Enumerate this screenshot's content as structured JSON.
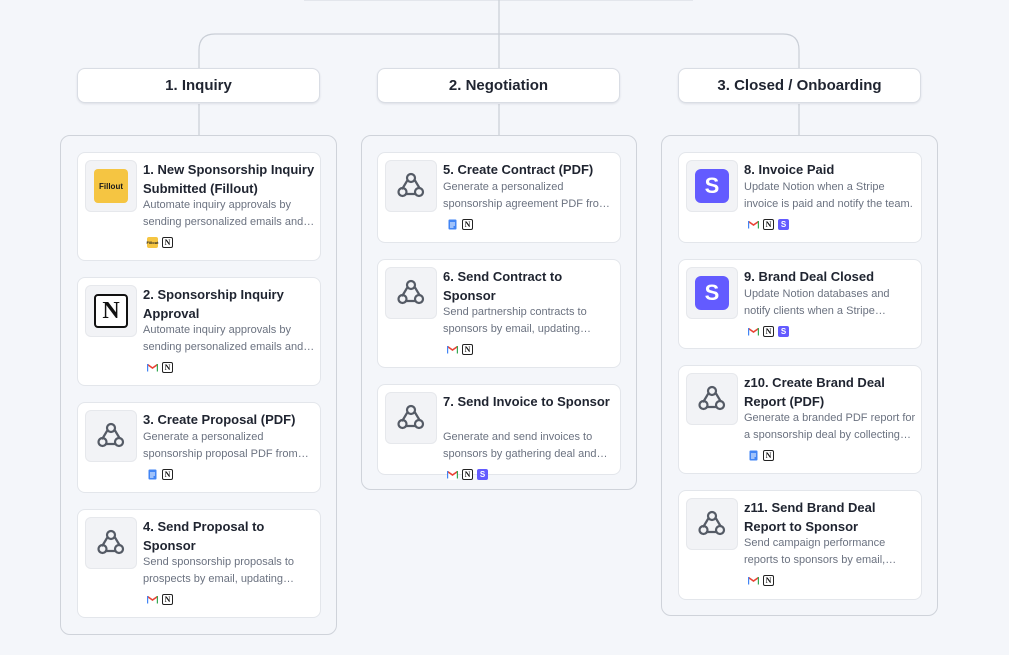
{
  "stages": [
    {
      "label": "1. Inquiry",
      "cards": [
        {
          "title": "1. New Sponsorship Inquiry Submitted (Fillout)",
          "desc": "Automate inquiry approvals by sending personalized emails and updating records.",
          "icon": "fillout-icon",
          "icon_text": "Fillout",
          "apps": [
            "fillout",
            "notion"
          ]
        },
        {
          "title": "2. Sponsorship Inquiry Approval",
          "desc": "Automate inquiry approvals by sending personalized emails and updating records.",
          "icon": "notion-icon",
          "icon_text": "N",
          "apps": [
            "gmail",
            "notion"
          ]
        },
        {
          "title": "3. Create Proposal (PDF)",
          "desc": "Generate a personalized sponsorship proposal PDF from Notion data.",
          "icon": "webhook-icon",
          "apps": [
            "docs",
            "notion"
          ]
        },
        {
          "title": "4. Send Proposal to Sponsor",
          "desc": "Send sponsorship proposals to prospects by email, updating records.",
          "icon": "webhook-icon",
          "apps": [
            "gmail",
            "notion"
          ]
        }
      ]
    },
    {
      "label": "2. Negotiation",
      "cards": [
        {
          "title": "5. Create Contract (PDF)",
          "desc": "Generate a personalized sponsorship agreement PDF from Notion data.",
          "icon": "webhook-icon",
          "apps": [
            "docs",
            "notion"
          ]
        },
        {
          "title": "6. Send Contract to Sponsor",
          "desc": "Send partnership contracts to sponsors by email, updating records.",
          "icon": "webhook-icon",
          "apps": [
            "gmail",
            "notion"
          ]
        },
        {
          "title": "7. Send Invoice to Sponsor",
          "desc": "Generate and send invoices to sponsors by gathering deal and billing data.",
          "icon": "webhook-icon",
          "apps": [
            "gmail",
            "notion",
            "stripe"
          ]
        }
      ]
    },
    {
      "label": "3. Closed / Onboarding",
      "cards": [
        {
          "title": "8. Invoice Paid",
          "desc": "Update Notion when a Stripe invoice is paid and notify the team.",
          "icon": "stripe-icon",
          "icon_text": "S",
          "apps": [
            "gmail",
            "notion",
            "stripe"
          ]
        },
        {
          "title": "9. Brand Deal Closed",
          "desc": "Update Notion databases and notify clients when a Stripe payment completes.",
          "icon": "stripe-icon",
          "icon_text": "S",
          "apps": [
            "gmail",
            "notion",
            "stripe"
          ]
        },
        {
          "title": "z10. Create Brand Deal Report (PDF)",
          "desc": "Generate a branded PDF report for a sponsorship deal by collecting data.",
          "icon": "webhook-icon",
          "apps": [
            "docs",
            "notion"
          ]
        },
        {
          "title": "z11. Send Brand Deal Report to Sponsor",
          "desc": "Send campaign performance reports to sponsors by email, updating records.",
          "icon": "webhook-icon",
          "apps": [
            "gmail",
            "notion"
          ]
        }
      ]
    }
  ],
  "app_glyphs": {
    "notion": "N",
    "stripe": "S",
    "fillout": "Fillout"
  }
}
